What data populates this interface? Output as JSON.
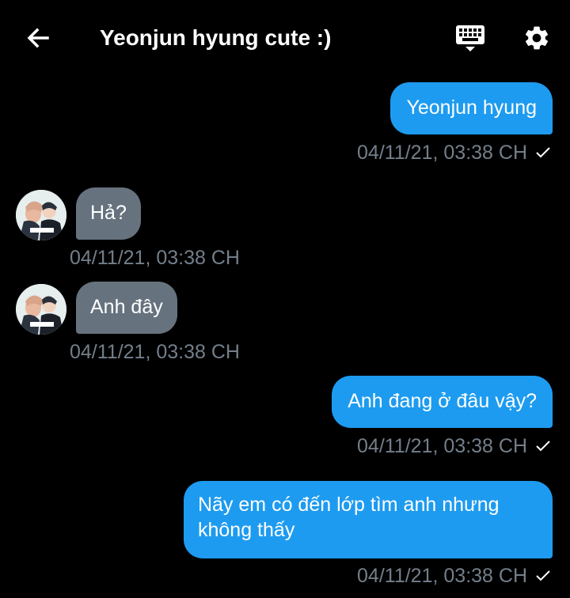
{
  "header": {
    "title": "Yeonjun hyung cute :)",
    "back_icon": "arrow-left-icon",
    "keyboard_icon": "keyboard-icon",
    "settings_icon": "gear-icon"
  },
  "colors": {
    "background": "#000000",
    "outgoing_bubble": "#1d9bf0",
    "incoming_bubble": "#66727e",
    "timestamp": "#737f8a"
  },
  "messages": [
    {
      "direction": "outgoing",
      "text": "Yeonjun hyung",
      "timestamp": "04/11/21, 03:38 CH",
      "read": true
    },
    {
      "direction": "incoming",
      "text": "Hả?",
      "timestamp": "04/11/21, 03:38 CH"
    },
    {
      "direction": "incoming",
      "text": "Anh đây",
      "timestamp": "04/11/21, 03:38 CH"
    },
    {
      "direction": "outgoing",
      "text": "Anh đang ở đâu vậy?",
      "timestamp": "04/11/21, 03:38 CH",
      "read": true
    },
    {
      "direction": "outgoing",
      "text_line1": "Nãy em có đến lớp tìm anh nhưng",
      "text_line2": "không thấy",
      "timestamp": "04/11/21, 03:38 CH",
      "read": true
    }
  ]
}
